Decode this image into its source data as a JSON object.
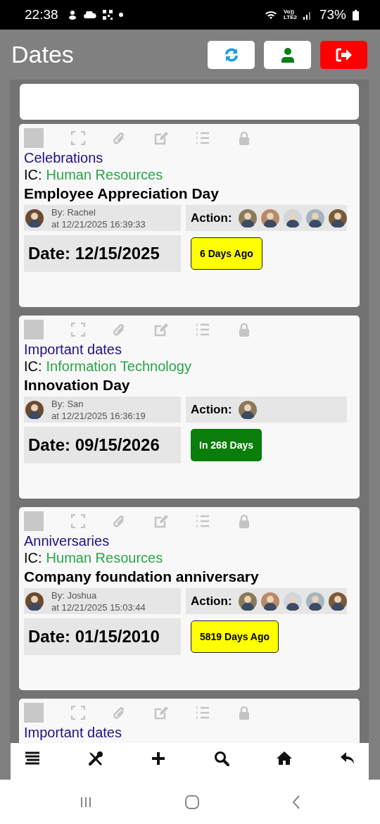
{
  "status_bar": {
    "time": "22:38",
    "volte": "Vo))",
    "network": "LTE2",
    "battery": "73%"
  },
  "header": {
    "title": "Dates"
  },
  "cards": [
    {
      "checked": false,
      "category": "Celebrations",
      "ic_label": "IC:",
      "ic_value": "Human Resources",
      "title": "Employee Appreciation Day",
      "by": "By: Rachel",
      "at": "at 12/21/2025 16:39:33",
      "action_label": "Action:",
      "action_avatars": [
        {
          "kind": "photo"
        },
        {
          "kind": "photo"
        },
        {
          "kind": "photo"
        },
        {
          "kind": "photo"
        },
        {
          "kind": "photo"
        }
      ],
      "date": "Date: 12/15/2025",
      "badge": {
        "text": "6 Days Ago",
        "kind": "past"
      }
    },
    {
      "checked": false,
      "category": "Important dates",
      "ic_label": "IC:",
      "ic_value": "Information Technology",
      "title": "Innovation Day",
      "by": "By: San",
      "at": "at 12/21/2025 16:36:19",
      "action_label": "Action:",
      "action_avatars": [
        {
          "kind": "photo"
        }
      ],
      "date": "Date: 09/15/2026",
      "badge": {
        "text": "In 268 Days",
        "kind": "future"
      }
    },
    {
      "checked": false,
      "category": "Anniversaries",
      "ic_label": "IC:",
      "ic_value": "Human Resources",
      "title": "Company foundation anniversary",
      "by": "By: Joshua",
      "at": "at 12/21/2025 15:03:44",
      "action_label": "Action:",
      "action_avatars": [
        {
          "kind": "photo"
        },
        {
          "kind": "photo"
        },
        {
          "kind": "photo"
        },
        {
          "kind": "photo"
        },
        {
          "kind": "photo"
        }
      ],
      "date": "Date: 01/15/2010",
      "badge": {
        "text": "5819 Days Ago",
        "kind": "past"
      }
    },
    {
      "checked": false,
      "category": "Important dates"
    }
  ]
}
